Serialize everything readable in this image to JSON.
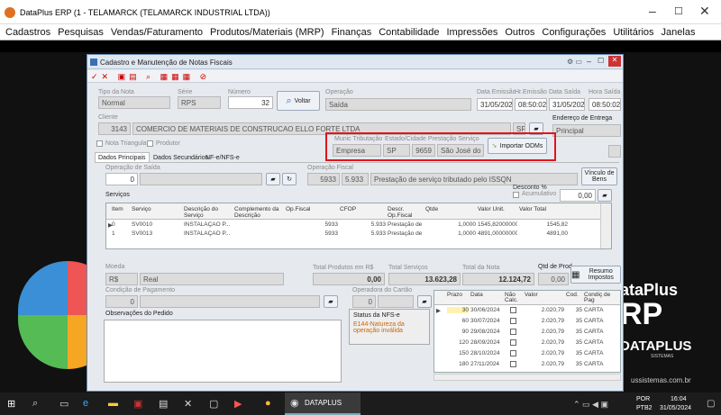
{
  "window": {
    "title": "DataPlus ERP (1 - TELAMARCK  (TELAMARCK INDUSTRIAL LTDA))"
  },
  "menu": [
    "Cadastros",
    "Pesquisas",
    "Vendas/Faturamento",
    "Produtos/Materiais (MRP)",
    "Finanças",
    "Contabilidade",
    "Impressões",
    "Outros",
    "Configurações",
    "Utilitários",
    "Janelas"
  ],
  "dialog": {
    "title": "Cadastro e Manutenção de Notas Fiscais"
  },
  "header": {
    "tipo_nota_label": "Tipo da Nota",
    "tipo_nota": "Normal",
    "serie_label": "Série",
    "serie": "RPS",
    "numero_label": "Número",
    "numero": "32",
    "voltar_label": "Voltar",
    "operacao_label": "Operação",
    "operacao": "Saída",
    "data_emissao_label": "Data Emissão",
    "data_emissao": "31/05/2024",
    "hr_emissao_label": "Hr.Emissão",
    "hr_emissao": "08:50:02",
    "data_saida_label": "Data Saída",
    "data_saida": "31/05/2024",
    "hora_saida_label": "Hora Saída",
    "hora_saida": "08:50:02"
  },
  "cliente": {
    "label": "Cliente",
    "codigo": "3143",
    "nome": "COMERCIO DE MATERIAIS DE CONSTRUCAO ELLO FORTE LTDA",
    "uf": "SP",
    "endereco_label": "Endereço de Entrega",
    "endereco": "Principal"
  },
  "triangular_label": "Nota Triangular",
  "produtor_label": "Produtor",
  "municipio": {
    "trib_label": "Munic Tributação",
    "trib": "Empresa",
    "estado_label": "Estado/Cidade Prestação Serviço",
    "uf": "SP",
    "cod": "9659",
    "cidade": "São José do R",
    "importar_label": "Importar ODMs"
  },
  "tabs": [
    "Dados Principais",
    "Dados Secundários",
    "NF-e/NFS-e"
  ],
  "op_saida": {
    "label": "Operação de Saída",
    "valor": "0"
  },
  "op_fiscal": {
    "label": "Operação Fiscal",
    "codigo": "5933",
    "cfop": "5.933",
    "descricao": "Prestação de serviço tributado pelo ISSQN",
    "vinculo_label": "Vínculo de Bens"
  },
  "servicos": {
    "label": "Serviços",
    "desconto_label": "Desconto %",
    "acumulativo_label": "Acumulativo",
    "desconto": "0,00",
    "qtde_total": "0,00"
  },
  "grid_cols": [
    "Item",
    "Serviço",
    "Descrição do Serviço",
    "Complemento da Descrição",
    "Op.Fiscal",
    "CFOP",
    "Descr. Op.Fiscal",
    "Qtde",
    "Valor Unit.",
    "Valor Total"
  ],
  "grid_rows": [
    [
      "0",
      "SV0010",
      "INSTALAÇÃO P...",
      "",
      "5933",
      "5.933",
      "Prestação de ser...",
      "1,0000",
      "1545,8200000000",
      "1545,82"
    ],
    [
      "1",
      "SV0013",
      "INSTALAÇÃO P...",
      "",
      "5933",
      "5.933",
      "Prestação de ser...",
      "1,0000",
      "4891,0000000000",
      "4891,00"
    ]
  ],
  "totais": {
    "moeda_label": "Moeda",
    "moeda": "R$",
    "moeda_nome": "Real",
    "produtos_label": "Total Produtos em R$",
    "produtos": "0,00",
    "servicos_label": "Total Serviços",
    "servicos": "13.623,28",
    "nota_label": "Total da Nota",
    "nota": "12.124,72",
    "qtd_prod_label": "Qtd de Prod.",
    "qtd_prod": "0,00",
    "resumo_label": "Resumo Impostos"
  },
  "pagamento": {
    "label": "Condição de Pagamento",
    "valor": "0",
    "operadora_label": "Operadora do Cartão",
    "operadora": "0"
  },
  "obs": {
    "label": "Observações do Pedido"
  },
  "nfse": {
    "label": "Status da NFS-e",
    "status": "E144-Natureza da operação inválida"
  },
  "parcelas": {
    "cols": [
      "Prazo",
      "Data",
      "Não Calc.",
      "Valor",
      "Cod.",
      "Condiç de Pag"
    ],
    "rows": [
      [
        "30",
        "30/06/2024",
        "2.020,79",
        "35",
        "CARTA"
      ],
      [
        "60",
        "30/07/2024",
        "2.020,79",
        "35",
        "CARTA"
      ],
      [
        "90",
        "29/08/2024",
        "2.020,79",
        "35",
        "CARTA"
      ],
      [
        "120",
        "28/09/2024",
        "2.020,79",
        "35",
        "CARTA"
      ],
      [
        "150",
        "28/10/2024",
        "2.020,79",
        "35",
        "CARTA"
      ],
      [
        "180",
        "27/11/2024",
        "2.020,79",
        "35",
        "CARTA"
      ]
    ]
  },
  "brand": {
    "line1": "ataPlus",
    "line2": "RP",
    "logo": "DATAPLUS",
    "sistemas": "SISTEMAS",
    "site": "ussistemas.com.br"
  },
  "taskbar": {
    "app": "DATAPLUS",
    "lang1": "POR",
    "lang2": "PTB2",
    "time": "16:04",
    "date": "31/05/2024"
  },
  "colors": {
    "highlight": "#e0151b",
    "accent": "#3a6fb5"
  }
}
